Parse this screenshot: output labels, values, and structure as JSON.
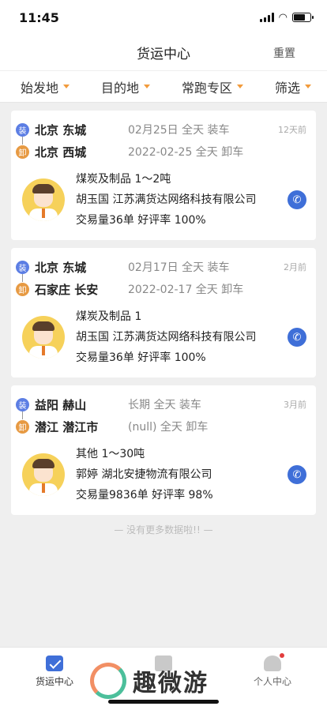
{
  "status_bar": {
    "time": "11:45"
  },
  "nav": {
    "title": "货运中心",
    "reset_label": "重置"
  },
  "filters": [
    {
      "label": "始发地"
    },
    {
      "label": "目的地"
    },
    {
      "label": "常跑专区"
    },
    {
      "label": "筛选"
    }
  ],
  "orders": [
    {
      "ago": "12天前",
      "load": {
        "badge": "装",
        "city": "北京 东城",
        "time": "02月25日 全天 装车"
      },
      "unload": {
        "badge": "卸",
        "city": "北京 西城",
        "time": "2022-02-25 全天 卸车"
      },
      "cargo": "煤炭及制品 1～2吨",
      "shipper": "胡玉国 江苏满货达网络科技有限公司",
      "stats": "交易量36单 好评率 100%"
    },
    {
      "ago": "2月前",
      "load": {
        "badge": "装",
        "city": "北京 东城",
        "time": "02月17日 全天 装车"
      },
      "unload": {
        "badge": "卸",
        "city": "石家庄 长安",
        "time": "2022-02-17 全天 卸车"
      },
      "cargo": "煤炭及制品 1",
      "shipper": "胡玉国 江苏满货达网络科技有限公司",
      "stats": "交易量36单 好评率 100%"
    },
    {
      "ago": "3月前",
      "load": {
        "badge": "装",
        "city": "益阳 赫山",
        "time": "长期 全天 装车"
      },
      "unload": {
        "badge": "卸",
        "city": "潜江 潜江市",
        "time": "(null) 全天 卸车"
      },
      "cargo": "其他 1～30吨",
      "shipper": "郭婷 湖北安捷物流有限公司",
      "stats": "交易量9836单 好评率 98%"
    }
  ],
  "footer_note": "— 没有更多数据啦!! —",
  "tabs": [
    {
      "label": "货运中心",
      "icon": "freight-icon"
    },
    {
      "label": "",
      "icon": "document-icon"
    },
    {
      "label": "个人中心",
      "icon": "profile-icon"
    }
  ],
  "watermark": {
    "text": "趣微游"
  },
  "colors": {
    "accent": "#3f6fd8",
    "load_badge": "#5c7ee4",
    "unload_badge": "#e79a43",
    "caret": "#f29b3c"
  }
}
